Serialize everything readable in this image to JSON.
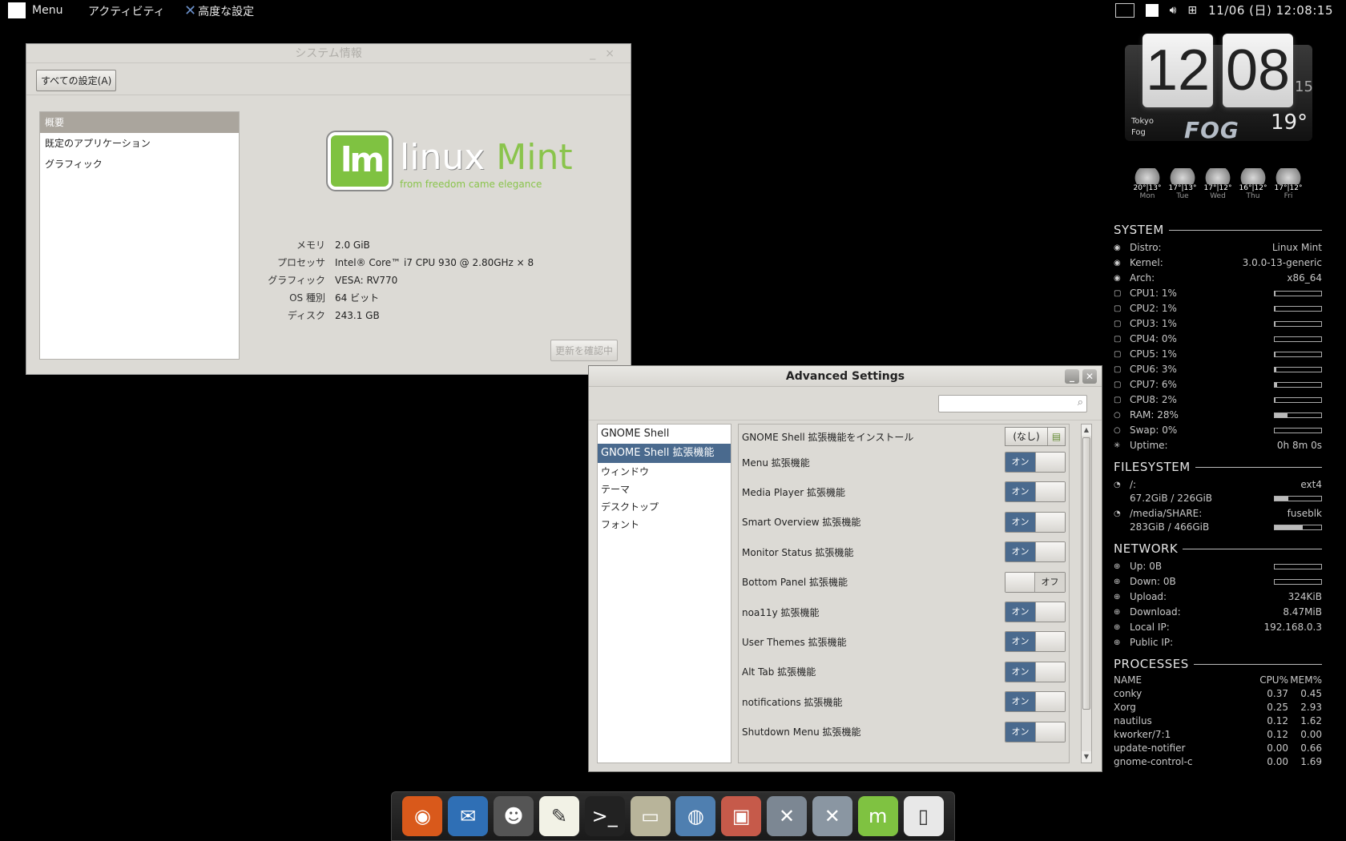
{
  "toppanel": {
    "menu_label": "Menu",
    "activities_label": "アクティビティ",
    "app_label": "高度な設定",
    "clock": "11/06 (日) 12:08:15"
  },
  "sysinfo": {
    "title": "システム情報",
    "all_settings_label": "すべての設定(A)",
    "sidebar": [
      "概要",
      "既定のアプリケーション",
      "グラフィック"
    ],
    "logo_text_1": "linux",
    "logo_text_2": "Mint",
    "logo_tagline": "from freedom came elegance",
    "specs": [
      {
        "k": "メモリ",
        "v": "2.0 GiB"
      },
      {
        "k": "プロセッサ",
        "v": "Intel® Core™ i7 CPU 930 @ 2.80GHz × 8"
      },
      {
        "k": "グラフィック",
        "v": "VESA: RV770"
      },
      {
        "k": "OS 種別",
        "v": "64 ビット"
      },
      {
        "k": "ディスク",
        "v": "243.1 GB"
      }
    ],
    "update_label": "更新を確認中"
  },
  "adv": {
    "title": "Advanced Settings",
    "search_placeholder": "",
    "categories": [
      "GNOME Shell",
      "GNOME Shell 拡張機能",
      "ウィンドウ",
      "テーマ",
      "デスクトップ",
      "フォント"
    ],
    "install_label": "GNOME Shell 拡張機能をインストール",
    "install_value": "(なし)",
    "on_label": "オン",
    "off_label": "オフ",
    "extensions": [
      {
        "name": "Menu 拡張機能",
        "state": "on"
      },
      {
        "name": "Media Player 拡張機能",
        "state": "on"
      },
      {
        "name": "Smart Overview 拡張機能",
        "state": "on"
      },
      {
        "name": "Monitor Status 拡張機能",
        "state": "on"
      },
      {
        "name": "Bottom Panel 拡張機能",
        "state": "off"
      },
      {
        "name": "noa11y 拡張機能",
        "state": "on"
      },
      {
        "name": "User Themes 拡張機能",
        "state": "on"
      },
      {
        "name": "Alt Tab 拡張機能",
        "state": "on"
      },
      {
        "name": "notifications 拡張機能",
        "state": "on"
      },
      {
        "name": "Shutdown Menu 拡張機能",
        "state": "on"
      }
    ]
  },
  "weather": {
    "hour": "12",
    "minute": "08",
    "second": "15",
    "city": "Tokyo",
    "condition": "Fog",
    "badge": "FOG",
    "temp": "19°",
    "forecast": [
      {
        "t": "20°|13°",
        "d": "Mon"
      },
      {
        "t": "17°|13°",
        "d": "Tue"
      },
      {
        "t": "17°|12°",
        "d": "Wed"
      },
      {
        "t": "16°|12°",
        "d": "Thu"
      },
      {
        "t": "17°|12°",
        "d": "Fri"
      }
    ]
  },
  "conky": {
    "system_title": "SYSTEM",
    "system": [
      {
        "l": "Distro:",
        "v": "Linux Mint"
      },
      {
        "l": "Kernel:",
        "v": "3.0.0-13-generic"
      },
      {
        "l": "Arch:",
        "v": "x86_64"
      }
    ],
    "cpus": [
      {
        "l": "CPU1: 1%",
        "p": 1
      },
      {
        "l": "CPU2: 1%",
        "p": 1
      },
      {
        "l": "CPU3: 1%",
        "p": 1
      },
      {
        "l": "CPU4: 0%",
        "p": 0
      },
      {
        "l": "CPU5: 1%",
        "p": 1
      },
      {
        "l": "CPU6: 3%",
        "p": 3
      },
      {
        "l": "CPU7: 6%",
        "p": 6
      },
      {
        "l": "CPU8: 2%",
        "p": 2
      },
      {
        "l": "RAM: 28%",
        "p": 28
      },
      {
        "l": "Swap: 0%",
        "p": 0
      }
    ],
    "uptime_label": "Uptime:",
    "uptime": "0h 8m 0s",
    "fs_title": "FILESYSTEM",
    "fs": [
      {
        "mount": "/:",
        "type": "ext4",
        "usage": "67.2GiB / 226GiB",
        "p": 30
      },
      {
        "mount": "/media/SHARE:",
        "type": "fuseblk",
        "usage": "283GiB / 466GiB",
        "p": 61
      }
    ],
    "net_title": "NETWORK",
    "net_bars": [
      {
        "l": "Up: 0B"
      },
      {
        "l": "Down: 0B"
      }
    ],
    "net": [
      {
        "l": "Upload:",
        "v": "324KiB"
      },
      {
        "l": "Download:",
        "v": "8.47MiB"
      },
      {
        "l": "Local IP:",
        "v": "192.168.0.3"
      },
      {
        "l": "Public IP:",
        "v": ""
      }
    ],
    "proc_title": "PROCESSES",
    "proc_header": {
      "n": "NAME",
      "c": "CPU%",
      "m": "MEM%"
    },
    "procs": [
      {
        "n": "conky",
        "c": "0.37",
        "m": "0.45"
      },
      {
        "n": "Xorg",
        "c": "0.25",
        "m": "2.93"
      },
      {
        "n": "nautilus",
        "c": "0.12",
        "m": "1.62"
      },
      {
        "n": "kworker/7:1",
        "c": "0.12",
        "m": "0.00"
      },
      {
        "n": "update-notifier",
        "c": "0.00",
        "m": "0.66"
      },
      {
        "n": "gnome-control-c",
        "c": "0.00",
        "m": "1.69"
      }
    ]
  },
  "dock": [
    {
      "name": "firefox-icon",
      "glyph": "◉",
      "bg": "#d9591b"
    },
    {
      "name": "thunderbird-icon",
      "glyph": "✉",
      "bg": "#2f6fb5"
    },
    {
      "name": "pidgin-icon",
      "glyph": "☻",
      "bg": "#555555"
    },
    {
      "name": "text-editor-icon",
      "glyph": "✎",
      "bg": "#f2f2e6"
    },
    {
      "name": "terminal-icon",
      "glyph": ">_",
      "bg": "#222222"
    },
    {
      "name": "file-manager-icon",
      "glyph": "▭",
      "bg": "#b8b49a"
    },
    {
      "name": "network-icon",
      "glyph": "◍",
      "bg": "#4f7fb0"
    },
    {
      "name": "package-manager-icon",
      "glyph": "▣",
      "bg": "#c65a4a"
    },
    {
      "name": "system-tools-icon",
      "glyph": "✕",
      "bg": "#7c8793"
    },
    {
      "name": "tweak-tool-icon",
      "glyph": "✕",
      "bg": "#8a96a2"
    },
    {
      "name": "mint-menu-icon",
      "glyph": "m",
      "bg": "#7fc241"
    },
    {
      "name": "switch-icon",
      "glyph": "▯",
      "bg": "#e8e8e8"
    }
  ]
}
